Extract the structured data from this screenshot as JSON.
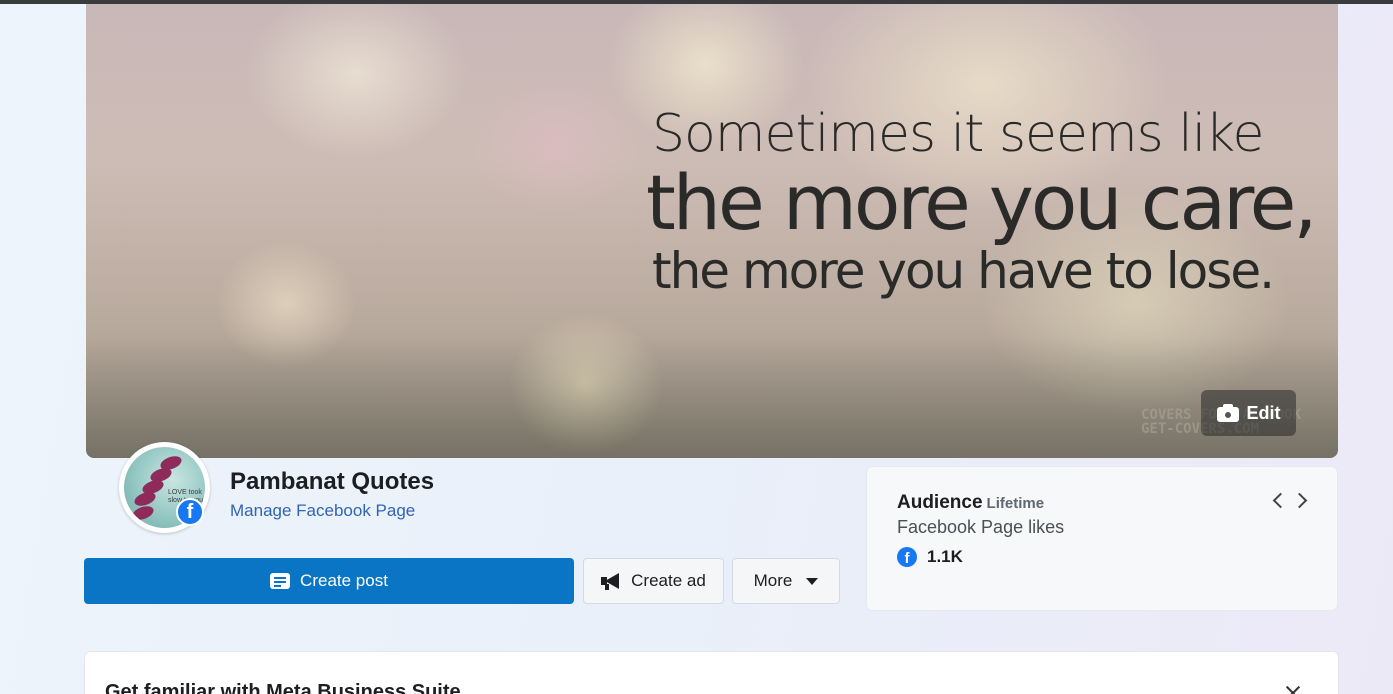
{
  "cover": {
    "quote_line1": "Sometimes it seems like",
    "quote_line2": "the more you care,",
    "quote_line3": "the more you have to lose.",
    "watermark_line1": "COVERS FOR FACEBOOK",
    "watermark_line2": "GET-COVERS.COM",
    "edit_label": "Edit",
    "edit_icon": "camera-icon"
  },
  "profile": {
    "avatar_text": "LOVE took slow to you",
    "badge_icon": "facebook-icon",
    "page_name": "Pambanat Quotes",
    "manage_link": "Manage Facebook Page"
  },
  "actions": {
    "create_post_label": "Create post",
    "create_post_icon": "post-icon",
    "create_ad_label": "Create ad",
    "create_ad_icon": "megaphone-icon",
    "more_label": "More",
    "more_icon": "caret-down-icon"
  },
  "audience": {
    "title": "Audience",
    "period": "Lifetime",
    "metric": "Facebook Page likes",
    "value": "1.1K",
    "icon": "facebook-icon"
  },
  "familiar": {
    "title": "Get familiar with Meta Business Suite"
  },
  "colors": {
    "primary": "#0a75c4",
    "facebook_blue": "#1877f2",
    "link": "#2f65b3"
  }
}
